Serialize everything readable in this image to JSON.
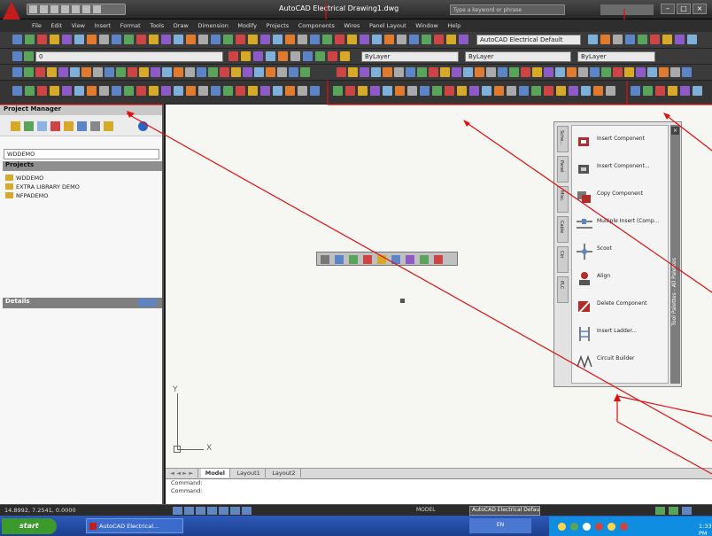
{
  "window": {
    "title": "AutoCAD Electrical Drawing1.dwg",
    "search_placeholder": "Type a keyword or phrase",
    "win_buttons": [
      "–",
      "□",
      "×"
    ]
  },
  "menu": [
    "File",
    "Edit",
    "View",
    "Insert",
    "Format",
    "Tools",
    "Draw",
    "Dimension",
    "Modify",
    "Projects",
    "Components",
    "Wires",
    "Panel Layout",
    "Window",
    "Help"
  ],
  "toolbars": {
    "workspace": "AutoCAD Electrical Default",
    "layer": "0",
    "color": "ByLayer",
    "linetype": "ByLayer",
    "lineweight": "ByLayer"
  },
  "project_manager": {
    "title": "Project Manager",
    "current_project": "WDDEMO",
    "projects_header": "Projects",
    "projects": [
      "WDDEMO",
      "EXTRA LIBRARY DEMO",
      "NFPADEMO"
    ],
    "details_header": "Details"
  },
  "tool_palette": {
    "side_title": "Tool Palettes - All Palettes",
    "tabs": [
      "Sche...",
      "Panel",
      "Misc.",
      "Cable",
      "Ckt",
      "PLC"
    ],
    "items": [
      {
        "label": "Insert Component",
        "icon": "insert-component-icon"
      },
      {
        "label": "Insert Component...",
        "icon": "insert-component-list-icon"
      },
      {
        "label": "Copy Component",
        "icon": "copy-component-icon"
      },
      {
        "label": "Multiple Insert (Comp...",
        "icon": "multiple-insert-icon"
      },
      {
        "label": "Scoot",
        "icon": "scoot-icon"
      },
      {
        "label": "Align",
        "icon": "align-icon"
      },
      {
        "label": "Delete Component",
        "icon": "delete-component-icon"
      },
      {
        "label": "Insert Ladder...",
        "icon": "insert-ladder-icon"
      },
      {
        "label": "Circuit Builder",
        "icon": "circuit-builder-icon"
      }
    ]
  },
  "layout_tabs": {
    "nav": "◄ ◄ ► ►",
    "tabs": [
      "Model",
      "Layout1",
      "Layout2"
    ],
    "active": "Model"
  },
  "command_line": [
    "Command:",
    "Command:"
  ],
  "ucs": {
    "x_label": "X",
    "y_label": "Y"
  },
  "status_bar": {
    "coordinates": "14.8992, 7.2541, 0.0000",
    "model": "MODEL",
    "workspace": "AutoCAD Electrical Default"
  },
  "taskbar": {
    "start": "start",
    "task": "AutoCAD Electrical...",
    "language": "EN",
    "clock": "1:33 PM"
  },
  "colors": {
    "annotation_line": "#e01010",
    "accent": "#5b85c7",
    "brand_red": "#c41d1d",
    "taskbar_blue": "#2d5ab8"
  }
}
